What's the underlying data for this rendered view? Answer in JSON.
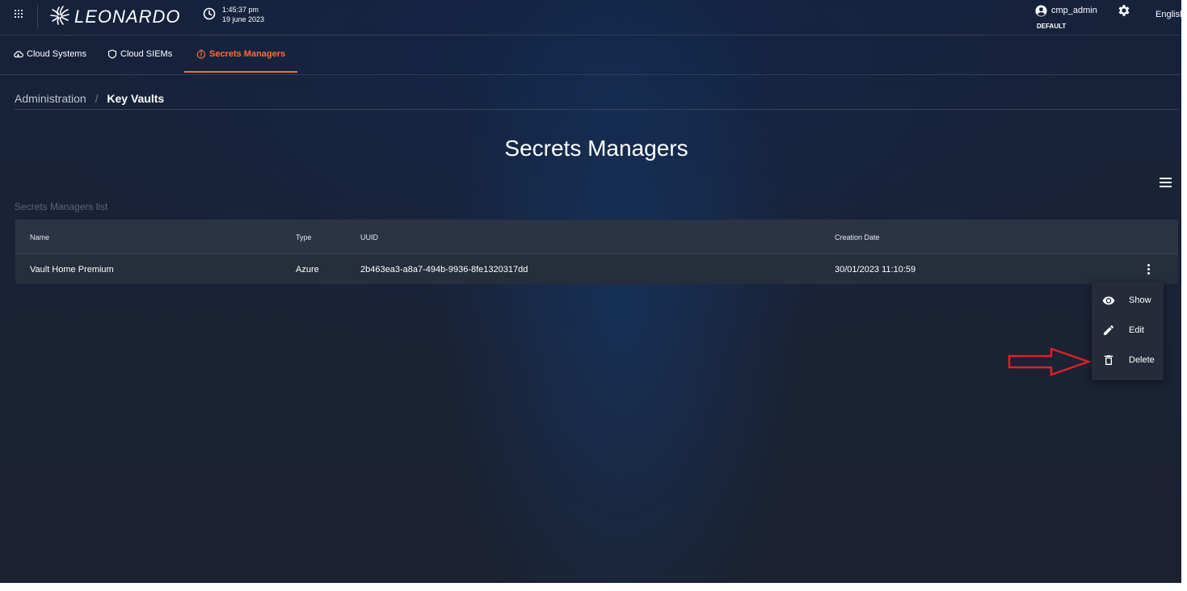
{
  "header": {
    "logo_text": "LEONARDO",
    "time": "1:45:37 pm",
    "date": "19 june 2023",
    "username": "cmp_admin",
    "role": "DEFAULT",
    "language": "English"
  },
  "tabs": [
    {
      "label": "Cloud Systems",
      "icon": "cloud-icon",
      "active": false
    },
    {
      "label": "Cloud SIEMs",
      "icon": "shield-icon",
      "active": false
    },
    {
      "label": "Secrets Managers",
      "icon": "secret-icon",
      "active": true
    }
  ],
  "breadcrumb": {
    "parent": "Administration",
    "separator": "/",
    "current": "Key Vaults"
  },
  "page": {
    "title": "Secrets Managers",
    "list_label": "Secrets Managers list"
  },
  "table": {
    "columns": [
      "Name",
      "Type",
      "UUID",
      "Creation Date"
    ],
    "rows": [
      {
        "name": "Vault Home Premium",
        "type": "Azure",
        "uuid": "2b463ea3-a8a7-494b-9936-8fe1320317dd",
        "creation_date": "30/01/2023 11:10:59"
      }
    ]
  },
  "context_menu": {
    "items": [
      {
        "label": "Show",
        "icon": "eye-icon"
      },
      {
        "label": "Edit",
        "icon": "pencil-icon"
      },
      {
        "label": "Delete",
        "icon": "trash-icon"
      }
    ]
  },
  "colors": {
    "accent": "#ff6c32",
    "annotation_arrow": "#e02020"
  }
}
